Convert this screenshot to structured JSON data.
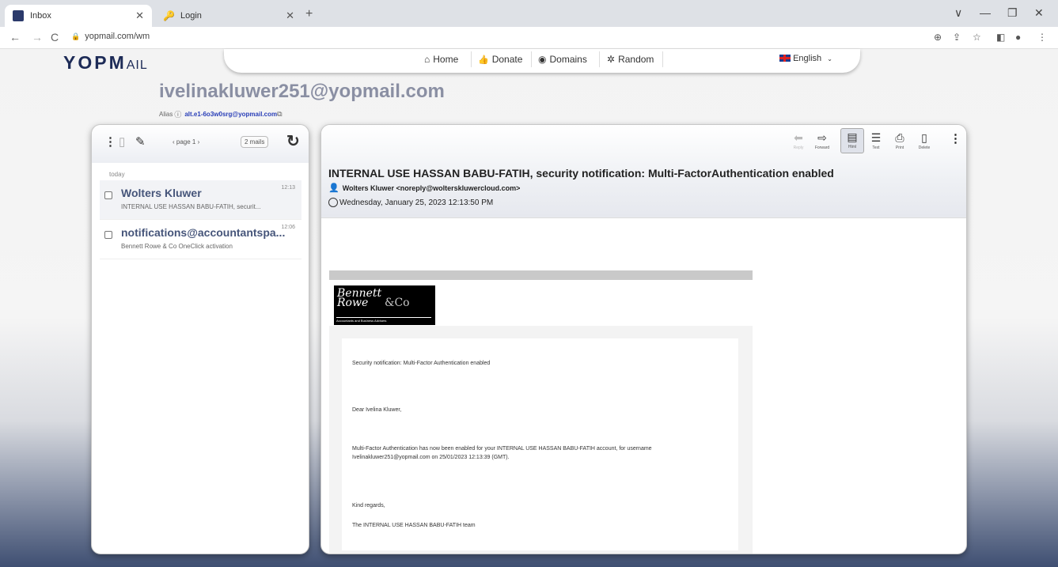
{
  "browser": {
    "tabs": [
      {
        "title": "Inbox",
        "icon": "yopmail-favicon",
        "active": true
      },
      {
        "title": "Login",
        "icon": "key-favicon",
        "active": false
      }
    ],
    "new_tab_glyph": "+",
    "url": "yopmail.com/wm",
    "nav": {
      "back": "←",
      "forward": "→",
      "reload": "C"
    },
    "window": {
      "minimize": "—",
      "restore": "❐",
      "close": "✕",
      "chevron": "∨"
    }
  },
  "site": {
    "logo_main": "YOPM",
    "logo_tail": "AIL",
    "nav": [
      {
        "label": "Home",
        "icon": "home-icon",
        "glyph": "⌂"
      },
      {
        "label": "Donate",
        "icon": "thumbs-up-icon",
        "glyph": "👍"
      },
      {
        "label": "Domains",
        "icon": "domains-icon",
        "glyph": "◉"
      },
      {
        "label": "Random",
        "icon": "random-icon",
        "glyph": "✲"
      }
    ],
    "language": "English"
  },
  "inbox": {
    "address": "ivelinakluwer251@yopmail.com",
    "alias_label": "Alias",
    "alias_value": "alt.e1-6o3w0srg@yopmail.com",
    "page_label": "page 1",
    "mail_count": "2 mails",
    "group_label": "today",
    "mails": [
      {
        "from": "Wolters Kluwer",
        "time": "12:13",
        "preview": "INTERNAL USE HASSAN BABU-FATIH, securit..."
      },
      {
        "from": "notifications@accountantspa...",
        "time": "12:06",
        "preview": "Bennett Rowe & Co OneClick activation"
      }
    ]
  },
  "message": {
    "toolbar": [
      {
        "label": "Reply",
        "icon": "reply-icon",
        "glyph": "⬅"
      },
      {
        "label": "Forward",
        "icon": "forward-icon",
        "glyph": "⇨"
      },
      {
        "label": "Html",
        "icon": "html-view-icon",
        "glyph": "▤"
      },
      {
        "label": "Text",
        "icon": "text-view-icon",
        "glyph": "☰"
      },
      {
        "label": "Print",
        "icon": "print-icon",
        "glyph": "⎙"
      },
      {
        "label": "Delete",
        "icon": "trash-icon",
        "glyph": "🗑"
      }
    ],
    "subject": "INTERNAL USE HASSAN BABU-FATIH, security notification: Multi-FactorAuthentication enabled",
    "sender": "Wolters Kluwer <noreply@wolterskluwercloud.com>",
    "date": "Wednesday, January 25, 2023 12:13:50 PM",
    "logo": {
      "line1": "Bennett",
      "line2": "Rowe",
      "co": "&Co",
      "tagline": "Accountants and Business Advisers"
    },
    "body": {
      "heading": "Security notification: Multi-Factor Authentication enabled",
      "greeting": "Dear Ivelina Kluwer,",
      "para": "Multi-Factor Authentication has now been enabled for your INTERNAL USE HASSAN BABU-FATIH account, for username Ivelinakluwer251@yopmail.com on 25/01/2023 12:13:39 (GMT).",
      "closing": "Kind regards,",
      "signature": "The INTERNAL USE HASSAN BABU-FATIH team"
    }
  }
}
